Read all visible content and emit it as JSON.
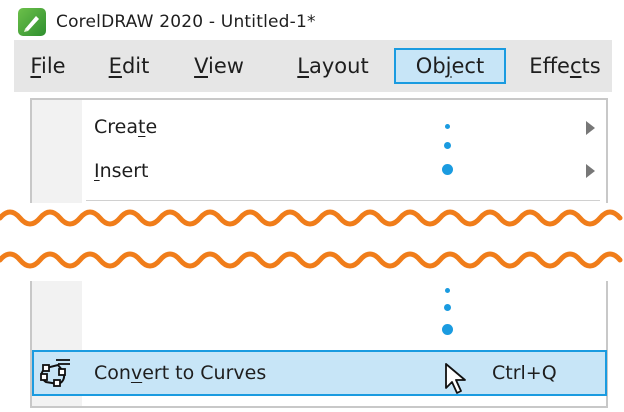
{
  "window": {
    "title": "CorelDRAW 2020 - Untitled-1*",
    "icon": "coreldraw-app-icon"
  },
  "menubar": {
    "items": [
      {
        "label_prefix": "",
        "mnemonic": "F",
        "label_suffix": "ile"
      },
      {
        "label_prefix": "",
        "mnemonic": "E",
        "label_suffix": "dit"
      },
      {
        "label_prefix": "",
        "mnemonic": "V",
        "label_suffix": "iew"
      },
      {
        "label_prefix": "",
        "mnemonic": "L",
        "label_suffix": "ayout"
      },
      {
        "label_prefix": "Ob",
        "mnemonic": "j",
        "label_suffix": "ect",
        "active": true
      },
      {
        "label_prefix": "Effe",
        "mnemonic": "c",
        "label_suffix": "ts"
      }
    ]
  },
  "dropdown": {
    "items": [
      {
        "label_prefix": "Crea",
        "mnemonic": "t",
        "label_suffix": "e",
        "has_submenu": true
      },
      {
        "label_prefix": "",
        "mnemonic": "I",
        "label_suffix": "nsert",
        "has_submenu": true
      }
    ],
    "highlighted": {
      "label_prefix": "Con",
      "mnemonic": "v",
      "label_suffix": "ert to Curves",
      "shortcut": "Ctrl+Q",
      "icon": "convert-to-curves-icon"
    }
  },
  "colors": {
    "accent": "#1a9be0",
    "highlight": "#c7e5f7",
    "wave": "#f07d1a",
    "menubar_bg": "#e6e6e6"
  }
}
